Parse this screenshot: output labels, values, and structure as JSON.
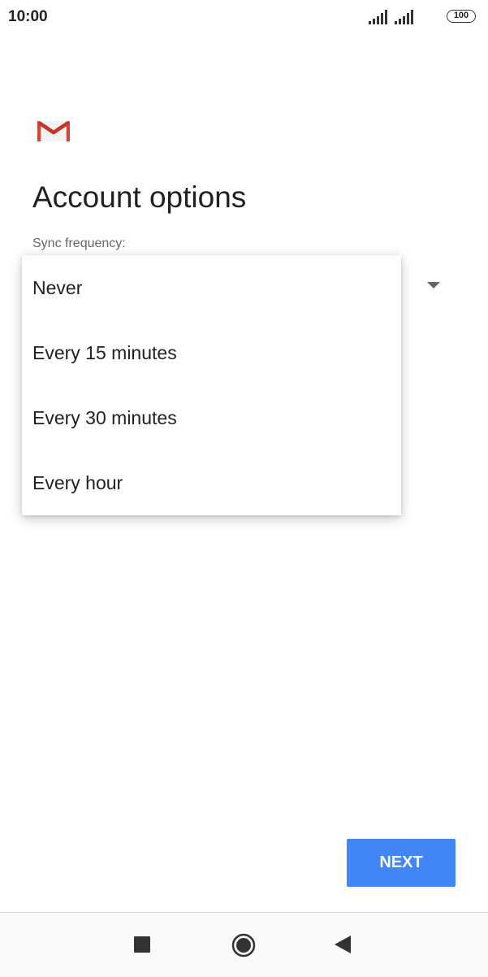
{
  "status_bar": {
    "time": "10:00",
    "battery_level": "100",
    "icons": [
      "signal-icon",
      "signal-icon",
      "battery-icon"
    ]
  },
  "app": {
    "logo_icon": "gmail-logo-icon",
    "title": "Account options"
  },
  "sync": {
    "label": "Sync frequency:",
    "options": [
      "Never",
      "Every 15 minutes",
      "Every 30 minutes",
      "Every hour"
    ]
  },
  "actions": {
    "next_label": "NEXT"
  },
  "nav_bar": {
    "icons": [
      "recents-icon",
      "home-icon",
      "back-icon"
    ]
  },
  "colors": {
    "accent": "#4285f4",
    "gmail_red": "#d44638",
    "text_primary": "#212121",
    "text_secondary": "#666666"
  }
}
